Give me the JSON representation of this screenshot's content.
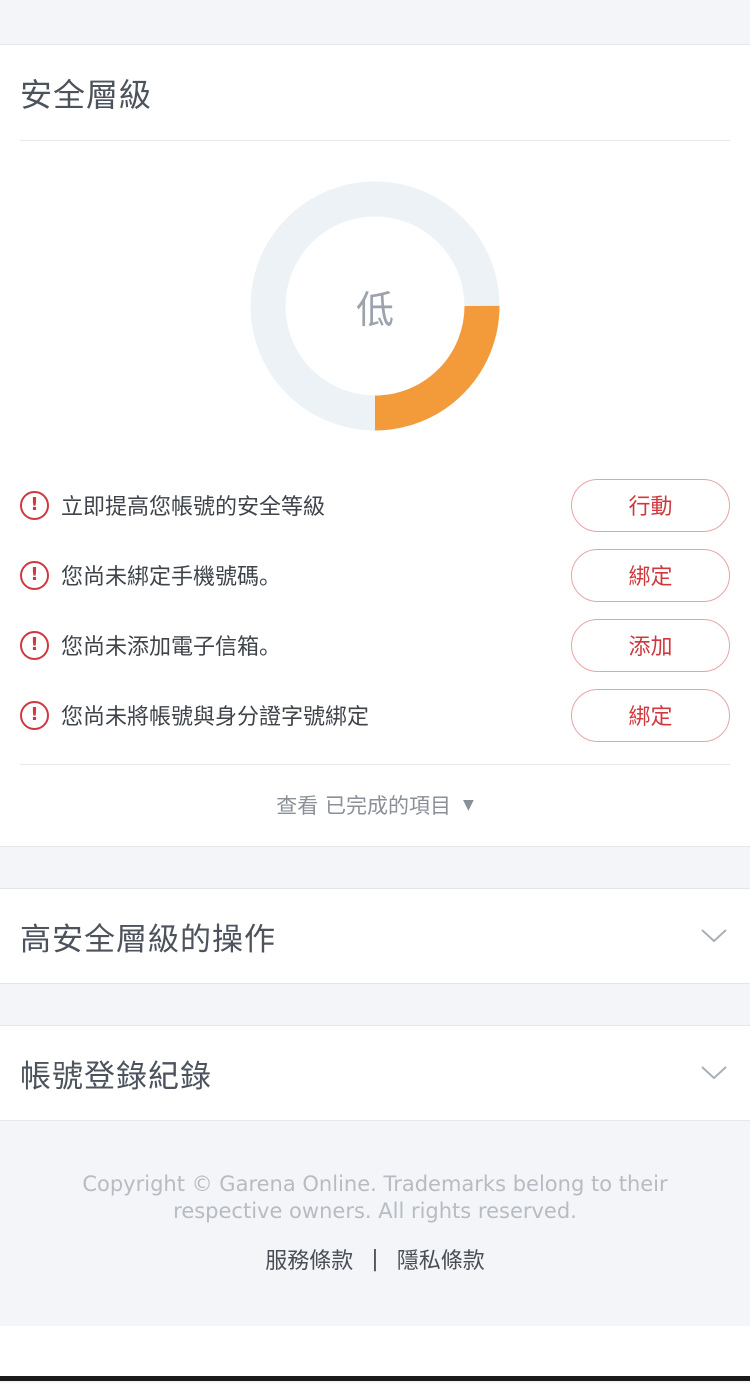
{
  "security": {
    "title": "安全層級",
    "level_label": "低",
    "level_fraction": 0.25,
    "ring_color": "#f39b3a",
    "ring_track_color": "#ecf2f6",
    "tasks": [
      {
        "text": "立即提高您帳號的安全等級",
        "button": "行動"
      },
      {
        "text": "您尚未綁定手機號碼。",
        "button": "綁定"
      },
      {
        "text": "您尚未添加電子信箱。",
        "button": "添加"
      },
      {
        "text": "您尚未將帳號與身分證字號綁定",
        "button": "綁定"
      }
    ],
    "alert_icon": "alert-circle-icon",
    "view_completed": "查看 已完成的項目"
  },
  "sections": [
    {
      "title": "高安全層級的操作"
    },
    {
      "title": "帳號登錄紀錄"
    }
  ],
  "footer": {
    "copyright_line1": "Copyright © Garena Online. Trademarks belong to their",
    "copyright_line2": "respective owners. All rights reserved.",
    "terms": "服務條款",
    "separator": "|",
    "privacy": "隱私條款"
  }
}
